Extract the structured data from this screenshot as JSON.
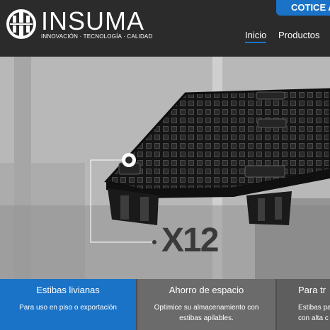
{
  "brand": {
    "name": "INSUMA",
    "tagline": "INNOVACIÓN · TECNOLOGÍA · CALIDAD"
  },
  "header": {
    "cta_label": "COTICE A",
    "nav": [
      {
        "label": "Inicio",
        "active": true
      },
      {
        "label": "Productos",
        "active": false
      }
    ]
  },
  "hero": {
    "badge": "X12"
  },
  "cards": [
    {
      "title": "Estibas livianas",
      "text": "Para uso en piso o exportación"
    },
    {
      "title": "Ahorro de espacio",
      "text": "Optimice su almacenamiento con estibas apilables."
    },
    {
      "title": "Para tr",
      "text": "Estibas pa con alta c"
    }
  ],
  "colors": {
    "header_bg": "#2b2b2b",
    "accent": "#1a73c7",
    "card_gray": "#6b6b6b"
  }
}
